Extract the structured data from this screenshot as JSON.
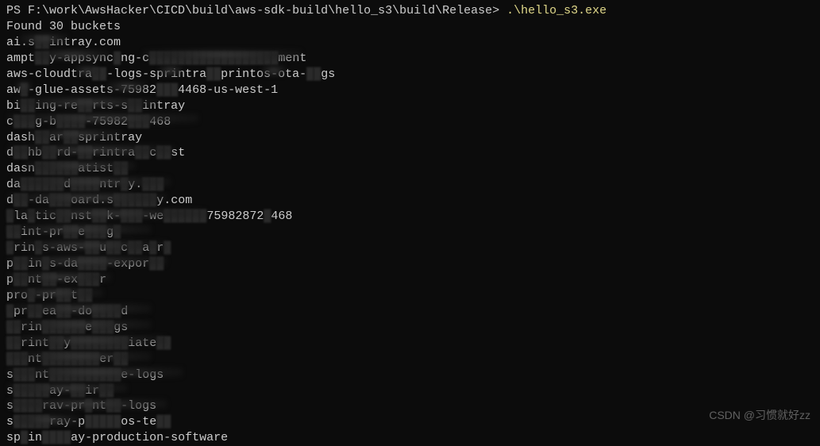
{
  "prompt": {
    "prefix": "PS ",
    "path": "F:\\work\\AwsHacker\\CICD\\build\\aws-sdk-build\\hello_s3\\build\\Release>",
    "command": ".\\hello_s3.exe"
  },
  "output": {
    "header": "Found 30 buckets",
    "buckets": [
      "ai.s██intray.com",
      "ampt██y-appsync█ng-c██████████████████ment",
      "aws-cloudtra██-logs-sprintra██printos-ota-██gs",
      "aw█-glue-assets-75982███4468-us-west-1",
      "bi██ing-re██rts-s██intray",
      "c███g-b████-75982███468",
      "dash██ar██sprintray",
      "d██hb██rd-██rintra██c██st",
      "dasn██████atist██",
      "da██████d████ntr█y.███",
      "d██-da███oard.s██████y.com",
      "█la█tic██nst██k-███-we██████75982872█468",
      "██int-pr██e███g█",
      "█rin█s-aws-██u██c██a█r█",
      "p██in█s-da████-expor██",
      "p██nt██-ex███r",
      "pro█-pr██t██",
      "█pr██ea██-do████d",
      "██rin██████e███gs",
      "██rint██y████████iate██",
      "███nt████████er██",
      "s███nt██████████e-logs",
      "s█████ay-██ir██",
      "s████rav-pr█nt██-logs",
      "s█████ray-p█████os-te██",
      "sp█in████ay-production-software"
    ]
  },
  "watermark": "CSDN @习惯就好zz"
}
